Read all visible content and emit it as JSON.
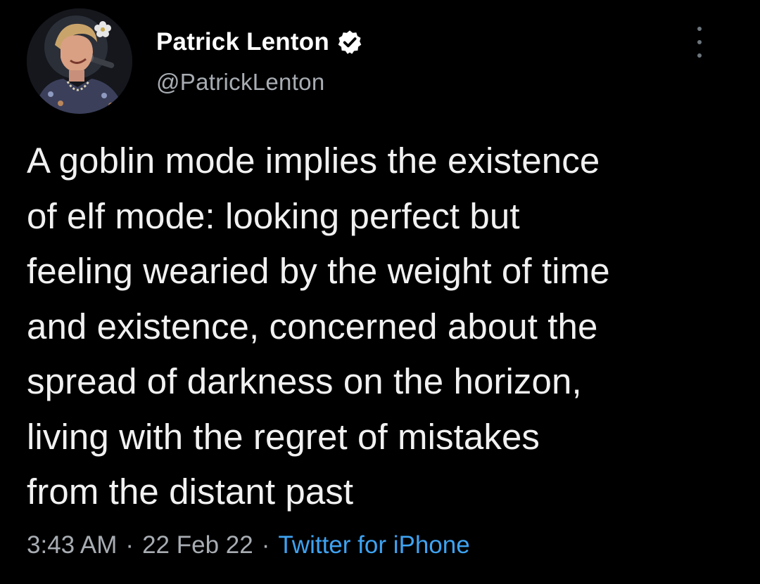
{
  "author": {
    "display_name": "Patrick Lenton",
    "handle": "@PatrickLenton",
    "verified": true,
    "avatar_icon": "profile-photo"
  },
  "tweet": {
    "text": "A goblin mode implies the existence\nof elf mode: looking perfect but\nfeeling wearied by the weight of time\nand existence, concerned about the\nspread of darkness on the horizon,\nliving with the regret of mistakes\nfrom the distant past"
  },
  "meta": {
    "time": "3:43 AM",
    "separator": "·",
    "date": "22 Feb 22",
    "source": "Twitter for iPhone"
  },
  "colors": {
    "background": "#000000",
    "text": "#f1f1f1",
    "secondary_text": "#a8adb3",
    "link": "#3ea3f2",
    "verified_badge": "#ffffff"
  },
  "icons": {
    "verified": "verified-badge-icon",
    "more": "more-options-icon"
  }
}
